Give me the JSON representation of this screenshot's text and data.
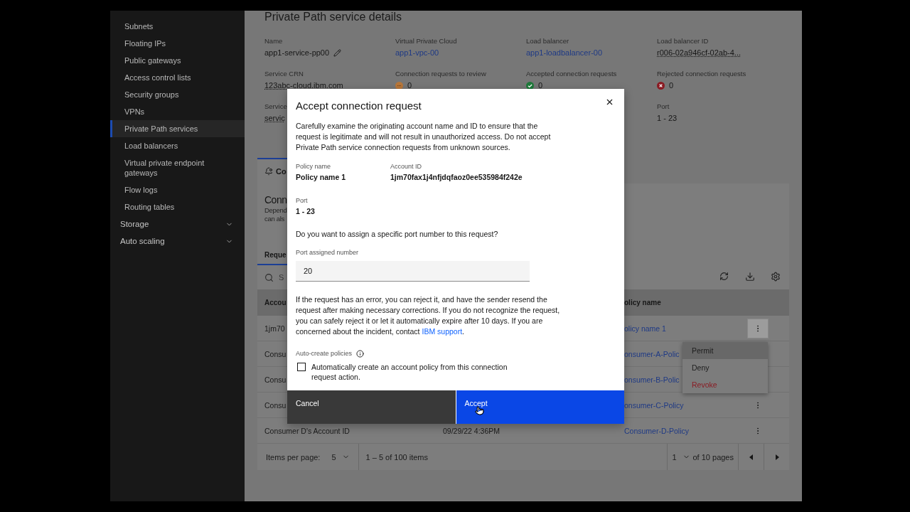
{
  "sidebar": {
    "items": [
      {
        "label": "Subnets",
        "kind": "link",
        "selected": false
      },
      {
        "label": "Floating IPs",
        "kind": "link",
        "selected": false
      },
      {
        "label": "Public gateways",
        "kind": "link",
        "selected": false
      },
      {
        "label": "Access control lists",
        "kind": "link",
        "selected": false
      },
      {
        "label": "Security groups",
        "kind": "link",
        "selected": false
      },
      {
        "label": "VPNs",
        "kind": "link",
        "selected": false
      },
      {
        "label": "Private Path services",
        "kind": "link",
        "selected": true
      },
      {
        "label": "Load balancers",
        "kind": "link",
        "selected": false
      },
      {
        "label": "Virtual private endpoint gateways",
        "kind": "link",
        "selected": false
      },
      {
        "label": "Flow logs",
        "kind": "link",
        "selected": false
      },
      {
        "label": "Routing tables",
        "kind": "link",
        "selected": false
      },
      {
        "label": "Storage",
        "kind": "category",
        "expanded": false
      },
      {
        "label": "Auto scaling",
        "kind": "category",
        "expanded": false
      }
    ]
  },
  "page": {
    "title": "Private Path service details",
    "details": [
      [
        {
          "label": "Name",
          "value": "app1-service-pp00",
          "kind": "editable"
        },
        {
          "label": "Virtual Private Cloud",
          "value": "app1-vpc-00",
          "kind": "link"
        },
        {
          "label": "Load balancer",
          "value": "app1-loadbalancer-00",
          "kind": "link"
        },
        {
          "label": "Load balancer ID",
          "value": "r006-02a946cf-02ab-4...",
          "kind": "underlined"
        }
      ],
      [
        {
          "label": "Service CRN",
          "value": "123abc-cloud.ibm.com",
          "kind": "underlined"
        },
        {
          "label": "Connection requests to review",
          "value": "0",
          "kind": "pending"
        },
        {
          "label": "Accepted connection requests",
          "value": "0",
          "kind": "accepted"
        },
        {
          "label": "Rejected connection requests",
          "value": "0",
          "kind": "rejected"
        }
      ],
      [
        {
          "label": "Service",
          "value": "servic",
          "kind": "underlined"
        },
        {
          "label": "Port",
          "value": "1 - 23",
          "kind": "text"
        }
      ]
    ]
  },
  "tabs": [
    {
      "label": "Co",
      "selected": true
    }
  ],
  "section": {
    "title": "Conn",
    "description_lines": [
      "Depend",
      "can als"
    ]
  },
  "sub_tabs": [
    {
      "label": "Reque",
      "selected": true
    }
  ],
  "search": {
    "placeholder": "S"
  },
  "table": {
    "columns": [
      {
        "label": "Accou"
      },
      {
        "label": "olicy name"
      }
    ],
    "rows": [
      {
        "account": "1jm70",
        "policy": "olicy name 1",
        "menu_open": true
      },
      {
        "account": "Consu",
        "policy": "onsumer-A-Polic",
        "menu_open": false
      },
      {
        "account": "Consu",
        "policy": "onsumer-B-Polic",
        "menu_open": false
      },
      {
        "account": "Consu",
        "policy": "onsumer-C-Policy",
        "menu_open": false
      },
      {
        "account": "Consumer D's Account ID",
        "created": "09/29/22 4:36PM",
        "policy": "Consumer-D-Policy",
        "menu_open": false
      }
    ]
  },
  "pagination": {
    "items_per_page_label": "Items per page:",
    "page_size": "5",
    "range": "1 – 5 of 100 items",
    "page": "1",
    "pages": "of 10 pages"
  },
  "row_menu": {
    "items": [
      {
        "label": "Permit",
        "kind": "normal",
        "selected": true
      },
      {
        "label": "Deny",
        "kind": "normal",
        "selected": false
      },
      {
        "label": "Revoke",
        "kind": "danger",
        "selected": false
      }
    ]
  },
  "dialog": {
    "title": "Accept connection request",
    "intro": "Carefully examine the originating account name and ID to ensure that the request is legitimate and will not result in unauthorized access. Do not accept Private Path service connection requests from unknown sources.",
    "fields": [
      {
        "label": "Policy name",
        "value": "Policy name 1"
      },
      {
        "label": "Account ID",
        "value": "1jm70fax1j4nfjdqfaoz0ee535984f242e"
      }
    ],
    "port": {
      "label": "Port",
      "value": "1 - 23"
    },
    "question": "Do you want to assign a specific port number to this request?",
    "input": {
      "label": "Port assigned number",
      "value": "20"
    },
    "note": "If the request has an error, you can reject it, and have the sender resend the request after making necessary corrections. If you do not recognize the request, you can safely reject it or let it automatically expire after 10 days. If you are concerned about the incident, contact",
    "note_link": "IBM support",
    "note_end": ".",
    "auto_create": {
      "label": "Auto-create policies",
      "checkbox_label": "Automatically create an account policy from this connection request action.",
      "checked": false
    },
    "buttons": [
      {
        "label": "Cancel",
        "kind": "secondary"
      },
      {
        "label": "Accept",
        "kind": "primary"
      }
    ]
  }
}
